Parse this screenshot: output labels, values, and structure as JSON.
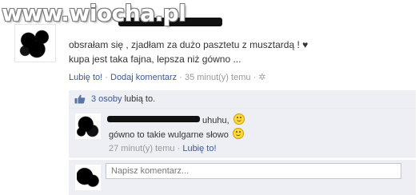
{
  "watermark": {
    "text": "www.wiocha.pl"
  },
  "post": {
    "text_line1": "obsrałam się , zjadłam za dużo pasztetu z musztardą ! ♥",
    "text_line2": "kupa jest taka fajna, lepsza niż gówno ...",
    "like_link": "Lubię to!",
    "comment_link": "Dodaj komentarz",
    "time": "35 minut(y) temu",
    "separator": "·",
    "gear_icon": "gear-icon"
  },
  "likes": {
    "count_link": "3 osoby",
    "suffix": "lubią to.",
    "thumb_icon": "thumbs-up-icon"
  },
  "comment": {
    "line1_tail": "uhuhu,",
    "line2": "gówno to takie wulgarne słowo",
    "time": "27 minut(y) temu",
    "like_link": "Lubię to!",
    "separator": "·"
  },
  "write_comment": {
    "placeholder": "Napisz komentarz..."
  },
  "colors": {
    "link": "#3b5998",
    "panel_bg": "#edeff4",
    "meta": "#999999"
  }
}
